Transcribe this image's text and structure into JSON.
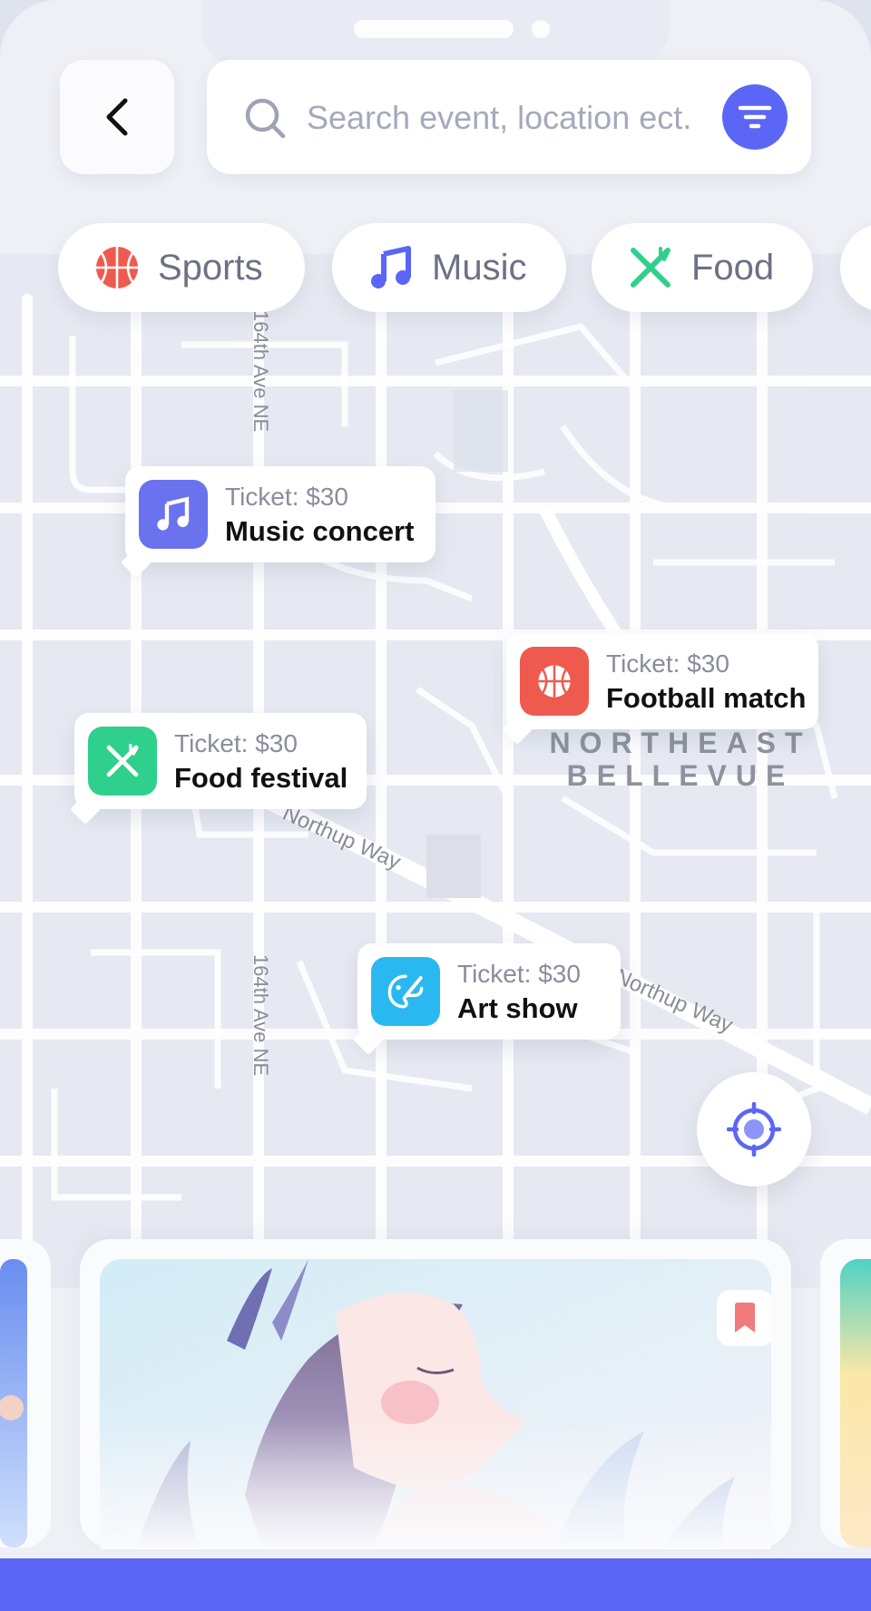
{
  "search": {
    "placeholder": "Search event, location ect."
  },
  "categories": [
    {
      "label": "Sports",
      "icon": "basketball-icon",
      "color": "#ef5a4e"
    },
    {
      "label": "Music",
      "icon": "music-note-icon",
      "color": "#5b66f6"
    },
    {
      "label": "Food",
      "icon": "fork-knife-icon",
      "color": "#2fd08c"
    }
  ],
  "map": {
    "area_label_line1": "NORTHEAST",
    "area_label_line2": "BELLEVUE",
    "street_1": "164th Ave NE",
    "street_2": "164th Ave NE",
    "street_3": "Northup Way",
    "street_4": "Northup Way"
  },
  "events": [
    {
      "ticket": "Ticket: $30",
      "title": "Music concert",
      "icon": "music-note-icon",
      "color": "#6a72ee"
    },
    {
      "ticket": "Ticket: $30",
      "title": "Football match",
      "icon": "basketball-icon",
      "color": "#ef5a4e"
    },
    {
      "ticket": "Ticket: $30",
      "title": "Food festival",
      "icon": "fork-knife-icon",
      "color": "#2fd08c"
    },
    {
      "ticket": "Ticket: $30",
      "title": "Art show",
      "icon": "palette-brush-icon",
      "color": "#2ab8f0"
    }
  ],
  "colors": {
    "accent": "#5b66f6",
    "bookmark": "#f07b7b"
  }
}
